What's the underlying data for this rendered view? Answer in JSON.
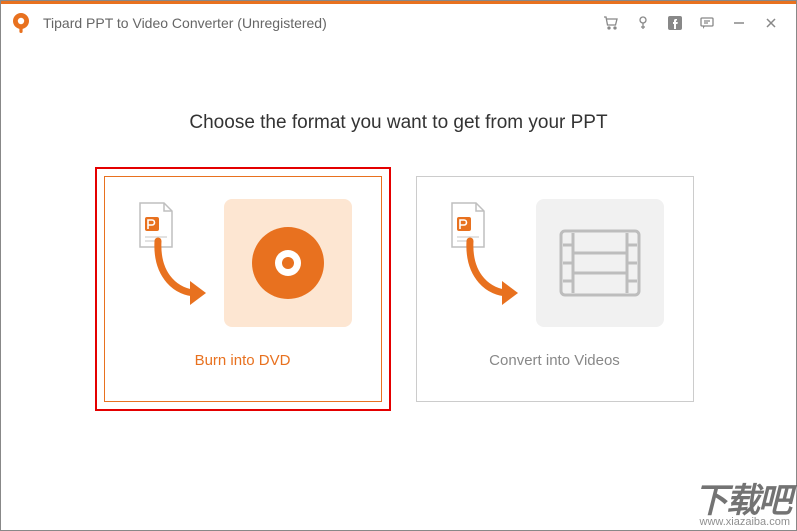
{
  "app": {
    "title": "Tipard PPT to Video Converter (Unregistered)"
  },
  "toolbar": {
    "icons": {
      "cart": "cart-icon",
      "key": "key-icon",
      "facebook": "facebook-icon",
      "feedback": "feedback-icon",
      "minimize": "minimize-icon",
      "close": "close-icon"
    }
  },
  "main": {
    "heading": "Choose the format you want to get from your PPT",
    "options": [
      {
        "id": "burn-dvd",
        "label": "Burn into DVD",
        "selected": true
      },
      {
        "id": "convert-video",
        "label": "Convert into Videos",
        "selected": false
      }
    ]
  },
  "watermark": {
    "main": "下载吧",
    "sub": "www.xiazaiba.com"
  }
}
